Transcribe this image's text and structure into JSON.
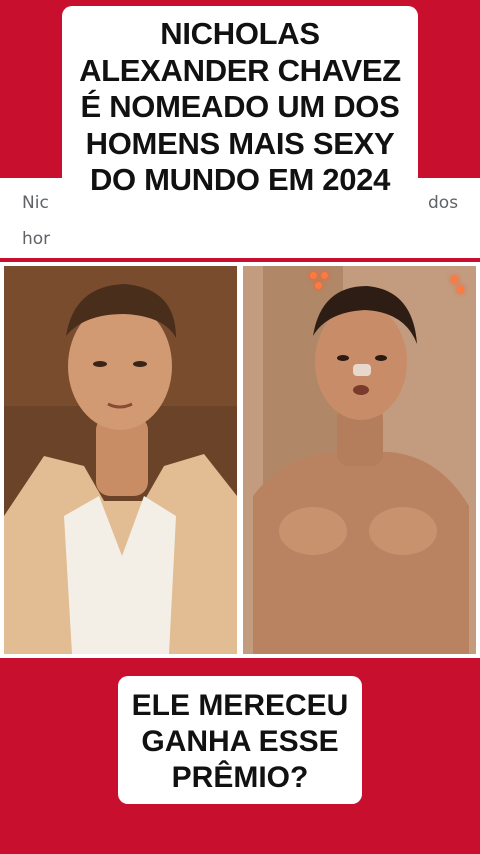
{
  "headline": {
    "lines": [
      "NICHOLAS",
      "ALEXANDER CHAVEZ",
      "É NOMEADO UM DOS",
      "HOMENS MAIS SEXY",
      "DO MUNDO EM 2024"
    ]
  },
  "article_snippet": {
    "left_line1": "Nic",
    "left_line2": "hor",
    "right_line1": "dos"
  },
  "question": {
    "lines": [
      "ELE MERECEU",
      "GANHA ESSE",
      "PRÊMIO?"
    ]
  },
  "colors": {
    "background": "#c8102e",
    "card": "#ffffff",
    "text": "#111111"
  }
}
